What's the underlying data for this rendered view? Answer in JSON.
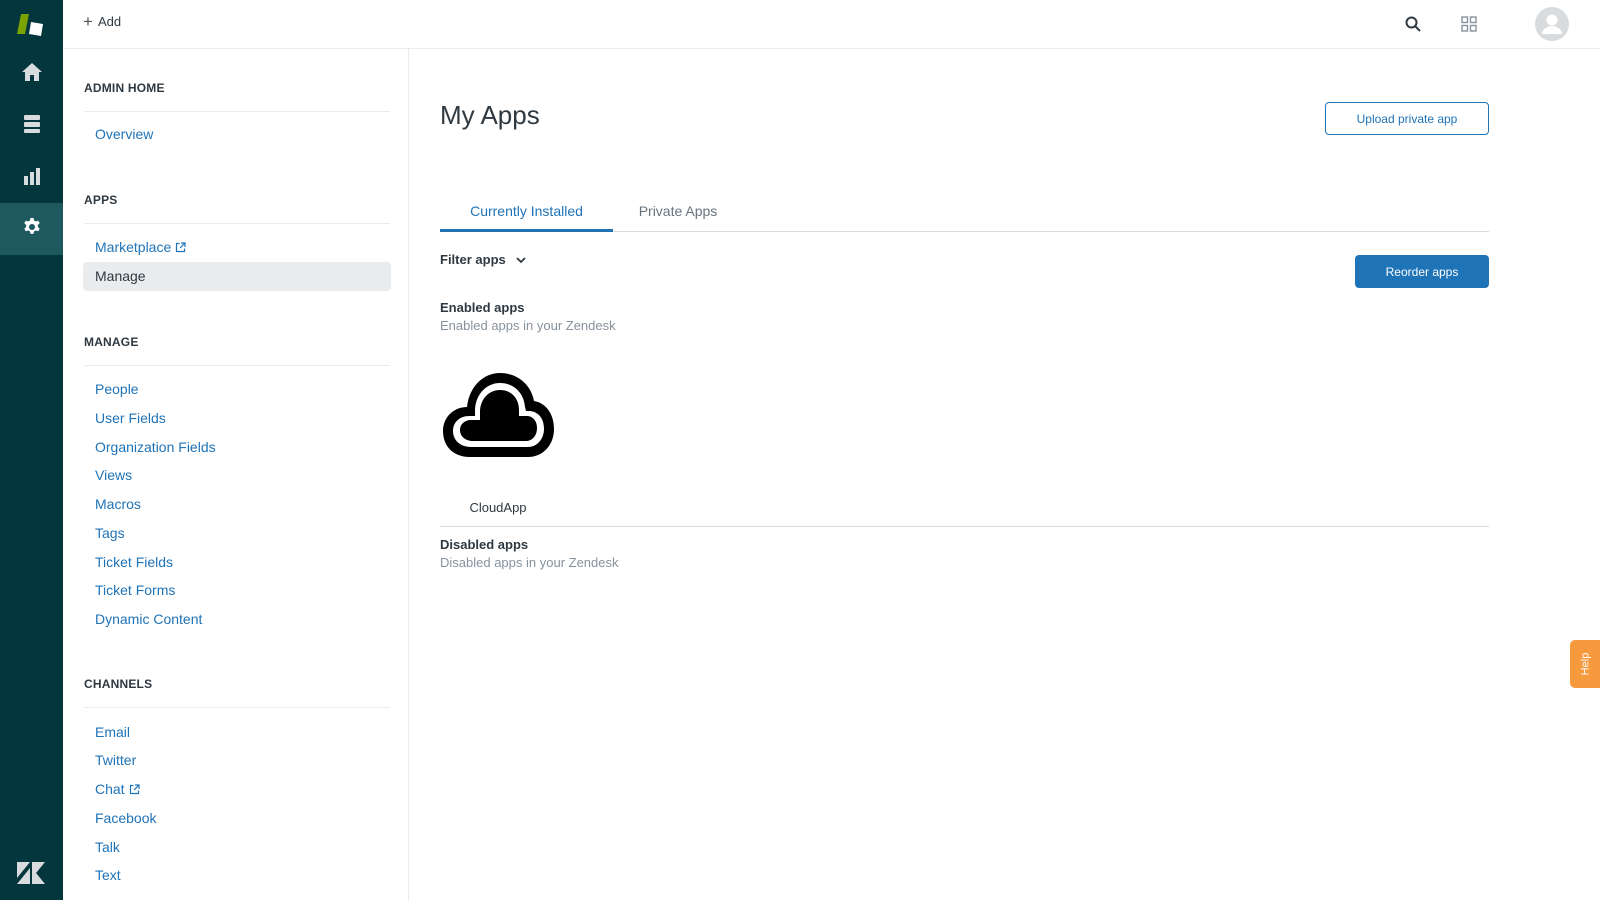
{
  "topbar": {
    "add_label": "Add"
  },
  "sidebar": {
    "sections": {
      "admin_home": {
        "title": "ADMIN HOME",
        "items": [
          "Overview"
        ]
      },
      "apps": {
        "title": "APPS",
        "items": [
          "Marketplace",
          "Manage"
        ]
      },
      "manage": {
        "title": "MANAGE",
        "items": [
          "People",
          "User Fields",
          "Organization Fields",
          "Views",
          "Macros",
          "Tags",
          "Ticket Fields",
          "Ticket Forms",
          "Dynamic Content"
        ]
      },
      "channels": {
        "title": "CHANNELS",
        "items": [
          "Email",
          "Twitter",
          "Chat",
          "Facebook",
          "Talk",
          "Text"
        ]
      }
    },
    "active_item": "Manage"
  },
  "main": {
    "title": "My Apps",
    "upload_button": "Upload private app",
    "tabs": [
      "Currently Installed",
      "Private Apps"
    ],
    "active_tab": "Currently Installed",
    "filter_label": "Filter apps",
    "reorder_button": "Reorder apps",
    "enabled": {
      "title": "Enabled apps",
      "subtitle": "Enabled apps in your Zendesk"
    },
    "apps": [
      {
        "name": "CloudApp",
        "icon": "cloud-icon"
      }
    ],
    "disabled": {
      "title": "Disabled apps",
      "subtitle": "Disabled apps in your Zendesk"
    }
  },
  "help_tab": "Help",
  "colors": {
    "rail": "#03363d",
    "accent": "#1f73b7",
    "help": "#f79a3e"
  }
}
